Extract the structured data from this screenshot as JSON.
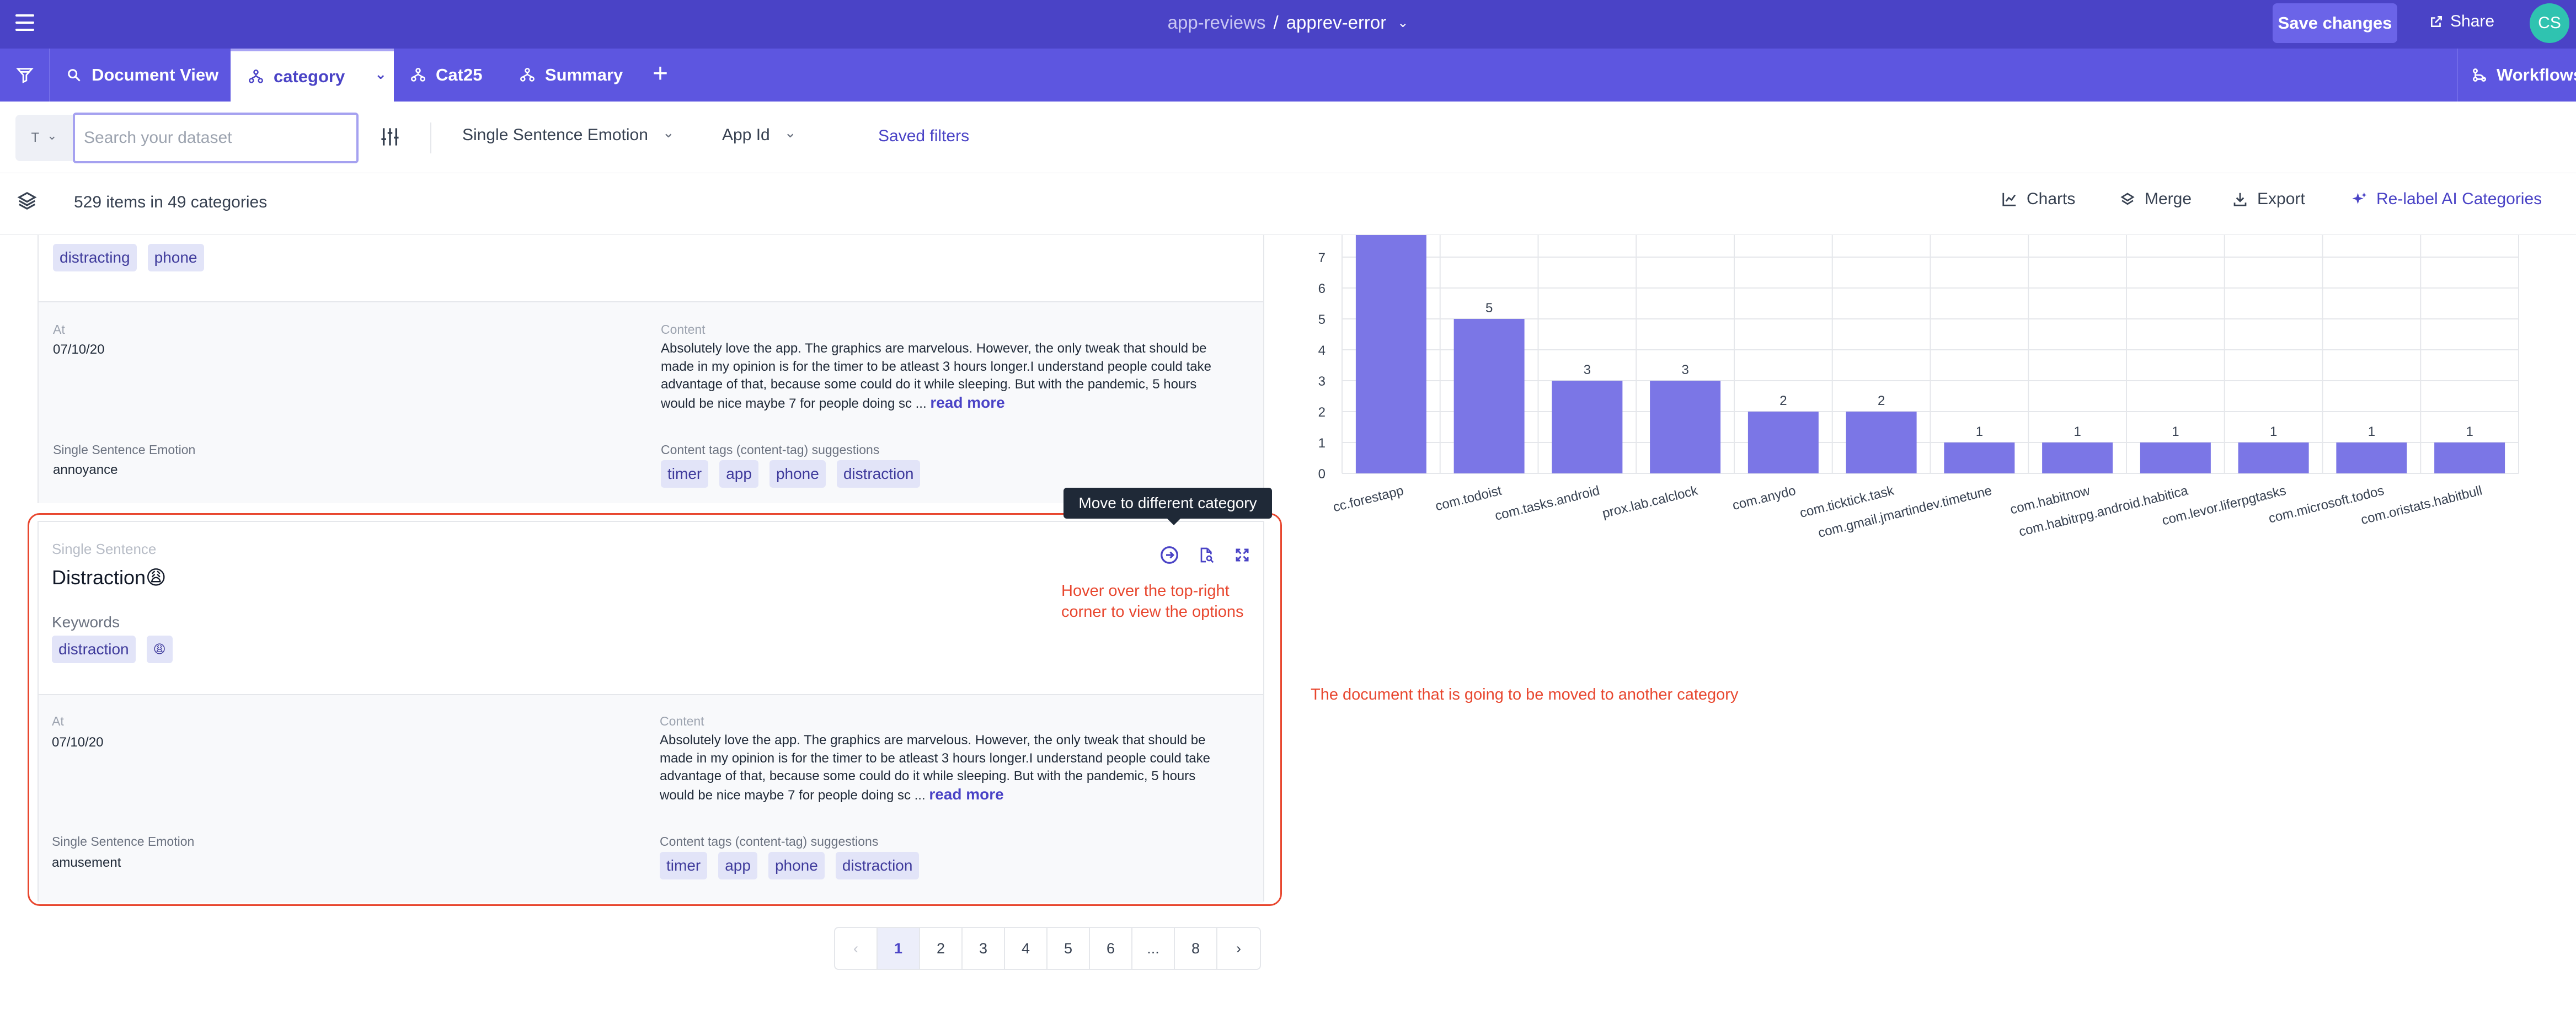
{
  "topbar": {
    "breadcrumb_parent": "app-reviews",
    "breadcrumb_sep": "/",
    "breadcrumb_current": "apprev-error",
    "save_label": "Save changes",
    "share_label": "Share",
    "avatar_initials": "CS"
  },
  "tabs": [
    {
      "label": "Document View",
      "icon": "search-icon"
    },
    {
      "label": "category",
      "icon": "hierarchy-icon",
      "active": true
    },
    {
      "label": "Cat25",
      "icon": "hierarchy-icon"
    },
    {
      "label": "Summary",
      "icon": "hierarchy-icon"
    }
  ],
  "tab_add": "+",
  "workflows_label": "Workflows",
  "filters": {
    "type_value": "T",
    "search_placeholder": "Search your dataset",
    "dropdown_1": "Single Sentence Emotion",
    "dropdown_2": "App Id",
    "saved_filters": "Saved filters"
  },
  "infobar": {
    "count": "529 items in 49 categories",
    "charts": "Charts",
    "merge": "Merge",
    "export": "Export",
    "relabel": "Re-label AI Categories"
  },
  "doc1": {
    "keywords": [
      "distracting",
      "phone"
    ],
    "at_label": "At",
    "at_value": "07/10/20",
    "content_label": "Content",
    "content_lines": [
      "Absolutely love the app. The graphics are marvelous. However, the only tweak that should be",
      "made in my opinion is for the timer to be atleast 3 hours longer.I understand people could take",
      "advantage of that, because some could do it while sleeping. But with the pandemic, 5 hours",
      "would be nice maybe 7 for people doing sc ..."
    ],
    "read_more": "read more",
    "emotion_label": "Single Sentence Emotion",
    "emotion_value": "annoyance",
    "tags_label": "Content tags (content-tag) suggestions",
    "tags": [
      "timer",
      "app",
      "phone",
      "distraction"
    ]
  },
  "doc2": {
    "section_label": "Single Sentence",
    "title": "Distraction😩",
    "keywords_label": "Keywords",
    "keywords": [
      "distraction",
      "😩"
    ],
    "at_label": "At",
    "at_value": "07/10/20",
    "content_label": "Content",
    "content_lines": [
      "Absolutely love the app. The graphics are marvelous. However, the only tweak that should be",
      "made in my opinion is for the timer to be atleast 3 hours longer.I understand people could take",
      "advantage of that, because some could do it while sleeping. But with the pandemic, 5 hours",
      "would be nice maybe 7 for people doing sc ..."
    ],
    "read_more": "read more",
    "emotion_label": "Single Sentence Emotion",
    "emotion_value": "amusement",
    "tags_label": "Content tags (content-tag) suggestions",
    "tags": [
      "timer",
      "app",
      "phone",
      "distraction"
    ]
  },
  "tooltip": "Move to different category",
  "annotation_hover": [
    "Hover over the top-right",
    "corner to view the options"
  ],
  "annotation_doc": "The document that is going to be moved to another category",
  "pagination": {
    "prev": "‹",
    "pages": [
      "1",
      "2",
      "3",
      "4",
      "5",
      "6",
      "...",
      "8"
    ],
    "active": "1",
    "next": "›"
  },
  "colors": {
    "brand": "#4a43c6",
    "tabbar": "#5d56e0",
    "bar": "#7b76e6",
    "annotation": "#e8472f"
  },
  "chart_data": {
    "type": "bar",
    "categories": [
      "cc.forestapp",
      "com.todoist",
      "com.tasks.android",
      "prox.lab.calclock",
      "com.anydo",
      "com.ticktick.task",
      "com.gmail.jmartindev.timetune",
      "com.habitnow",
      "com.habitrpg.android.habitica",
      "com.levor.liferpgtasks",
      "com.microsoft.todos",
      "com.oristats.habitbull"
    ],
    "values": [
      8,
      5,
      3,
      3,
      2,
      2,
      1,
      1,
      1,
      1,
      1,
      1
    ],
    "data_labels": [
      "",
      "5",
      "3",
      "3",
      "2",
      "2",
      "1",
      "1",
      "1",
      "1",
      "1",
      "1"
    ],
    "yticks": [
      "0",
      "1",
      "2",
      "3",
      "4",
      "5",
      "6",
      "7"
    ],
    "ylim": [
      0,
      7.8
    ],
    "grid": true
  }
}
